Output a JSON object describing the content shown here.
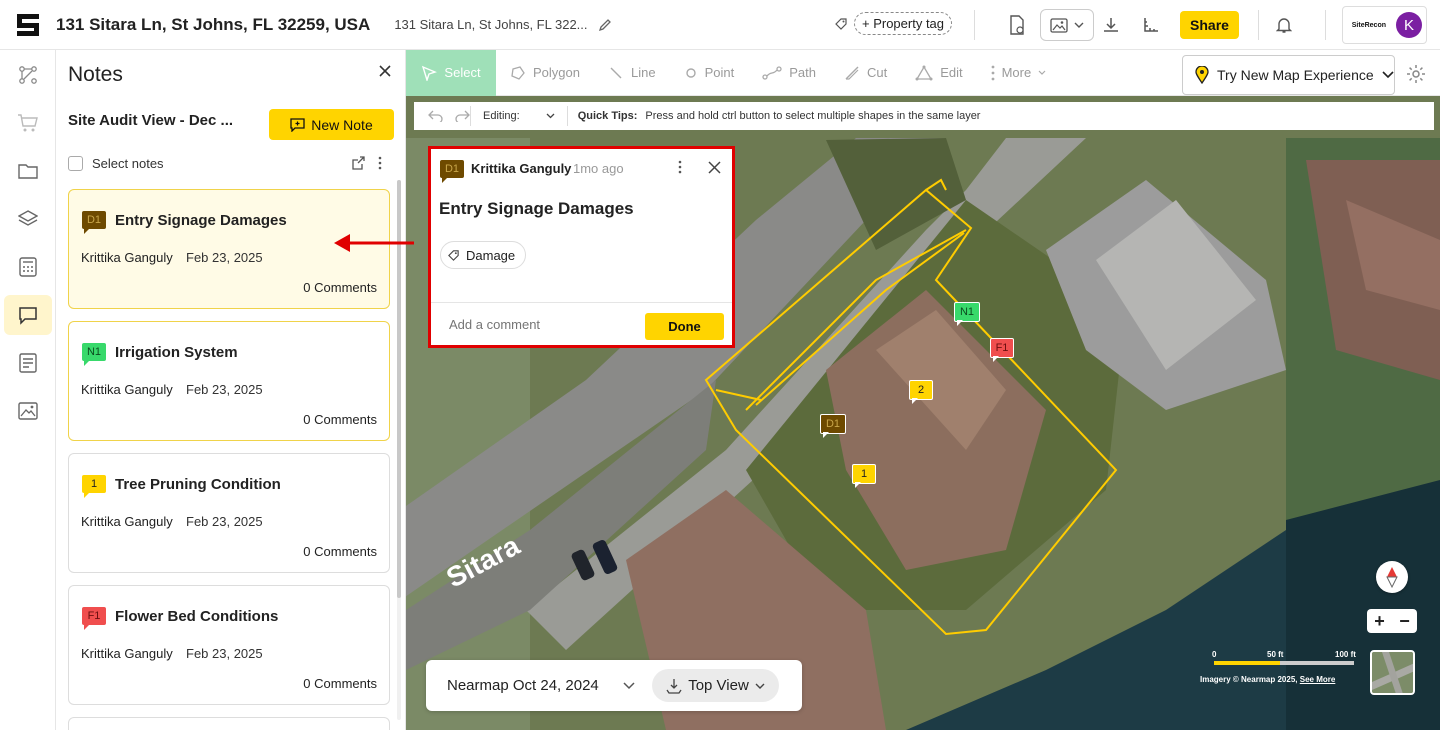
{
  "header": {
    "address_title": "131 Sitara Ln, St Johns, FL 32259, USA",
    "address_sub": "131 Sitara Ln, St Johns, FL 322...",
    "property_tag": "+ Property tag",
    "share": "Share",
    "brand": "SiteRecon",
    "avatar_initial": "K",
    "avatar_color": "#7b1fa2"
  },
  "sidebar": {
    "items": [
      "workflow-icon",
      "cart-icon",
      "folder-icon",
      "layers-icon",
      "calculator-icon",
      "comment-icon",
      "document-icon",
      "image-icon"
    ],
    "active_index": 5
  },
  "notes": {
    "title": "Notes",
    "view_name": "Site Audit View - Dec ...",
    "new_note": "New Note",
    "select_notes": "Select notes",
    "cards": [
      {
        "badge": "D1",
        "title": "Entry Signage Damages",
        "author": "Krittika Ganguly",
        "date": "Feb 23, 2025",
        "comments": "0 Comments"
      },
      {
        "badge": "N1",
        "title": "Irrigation System",
        "author": "Krittika Ganguly",
        "date": "Feb 23, 2025",
        "comments": "0 Comments"
      },
      {
        "badge": "1",
        "title": "Tree Pruning Condition",
        "author": "Krittika Ganguly",
        "date": "Feb 23, 2025",
        "comments": "0 Comments"
      },
      {
        "badge": "F1",
        "title": "Flower Bed Conditions",
        "author": "Krittika Ganguly",
        "date": "Feb 23, 2025",
        "comments": "0 Comments"
      }
    ]
  },
  "toolbar": {
    "tools": [
      "Select",
      "Polygon",
      "Line",
      "Point",
      "Path",
      "Cut",
      "Edit",
      "More"
    ],
    "try_new": "Try New Map Experience",
    "editing": "Editing:",
    "quick_tips_label": "Quick Tips:",
    "quick_tips_text": "Press and hold ctrl button to select multiple shapes in the same layer"
  },
  "popup": {
    "badge": "D1",
    "author": "Krittika Ganguly",
    "time": "1mo ago",
    "title": "Entry Signage Damages",
    "tag": "Damage",
    "comment_placeholder": "Add a comment",
    "done": "Done"
  },
  "map": {
    "street_label": "Sitara",
    "markers": [
      "N1",
      "F1",
      "2",
      "D1",
      "1"
    ],
    "date_label": "Nearmap Oct 24, 2024",
    "view_label": "Top View",
    "scale": [
      "0",
      "50 ft",
      "100 ft"
    ],
    "credit": "Imagery © Nearmap 2025,",
    "see_more": "See More",
    "colors": {
      "accent": "#ffd400",
      "outline": "#ffcc00",
      "popup_border": "#e00000"
    }
  }
}
